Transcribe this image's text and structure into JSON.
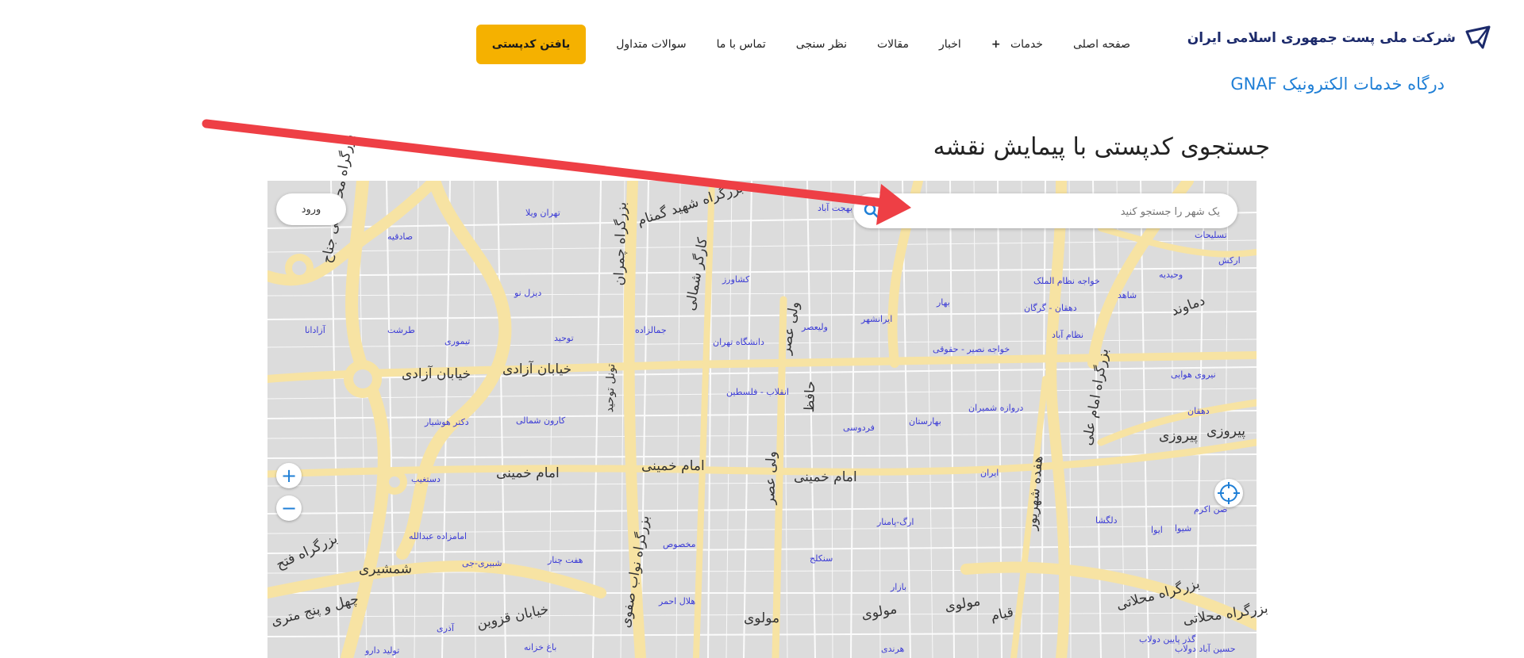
{
  "header": {
    "logo_text": "شرکت ملی پست جمهوری اسلامی ایران",
    "subtitle": "درگاه خدمات الکترونیک GNAF",
    "nav": [
      {
        "label": "صفحه اصلی"
      },
      {
        "label": "خدمات"
      },
      {
        "label": "اخبار"
      },
      {
        "label": "مقالات"
      },
      {
        "label": "نظر سنجی"
      },
      {
        "label": "تماس با ما"
      },
      {
        "label": "سوالات متداول"
      }
    ],
    "cta_label": "یافتن کدپستی",
    "accent": "#f5b100"
  },
  "page": {
    "title": "جستجوی کدپستی با پیمایش نقشه"
  },
  "map": {
    "search_placeholder": "یک شهر را جستجو کنید",
    "login_label": "ورود",
    "zoom_in": "+",
    "zoom_out": "−",
    "streets": [
      "خیابان آزادی",
      "خیابان آزادی",
      "امام خمینی",
      "امام خمینی",
      "امام خمینی",
      "بزرگراه محمدعلی جناح",
      "بزرگراه چمران",
      "کارگر شمالی",
      "ولی عصر",
      "حافظ",
      "ولی عصر",
      "بزرگراه امام علی",
      "هفده شهریور",
      "پیروزی",
      "پیروزی",
      "دماوند",
      "بزرگراه محلاتی",
      "بزرگراه محلاتی",
      "قیام",
      "مولوی",
      "مولوی",
      "مولوی",
      "خیابان قزوین",
      "شمشیری",
      "بزرگراه فتح",
      "چهل و پنج متری",
      "بزرگراه شهید گمنام",
      "بزرگراه نواب صفوی",
      "تونل توحید"
    ],
    "places": [
      "تهران ویلا",
      "صادقیه",
      "دیزل نو",
      "آزادانا",
      "طرشت",
      "تیموری",
      "توحید",
      "جمالزاده",
      "دانشگاه تهران",
      "کشاورز",
      "بهجت آباد",
      "ولیعصر",
      "ایرانشهر",
      "بهار",
      "خواجه نظام الملک",
      "دهقان - گرگان",
      "نظام آباد",
      "خواجه نصیر - حقوقی",
      "شاهد",
      "وحیدیه",
      "تسلیحات",
      "ارکش",
      "نیروی هوایی",
      "دهقان",
      "انقلاب - فلسطین",
      "کارون شمالی",
      "دکتر هوشیار",
      "فردوسی",
      "بهارستان",
      "دروازه شمیران",
      "ایران",
      "دستغیب",
      "امامزاده عبدالله",
      "شبیری-جی",
      "هفت چنار",
      "مخصوص",
      "ارگ-پامنار",
      "سنکلج",
      "بازار",
      "هلال احمر",
      "باغ خزانه",
      "هرندی",
      "آذری",
      "تولید دارو",
      "گذر پایین دولاب",
      "حسین آباد دولاب",
      "دلگشا",
      "شیوا",
      "ایوا",
      "صن اکرم"
    ]
  }
}
